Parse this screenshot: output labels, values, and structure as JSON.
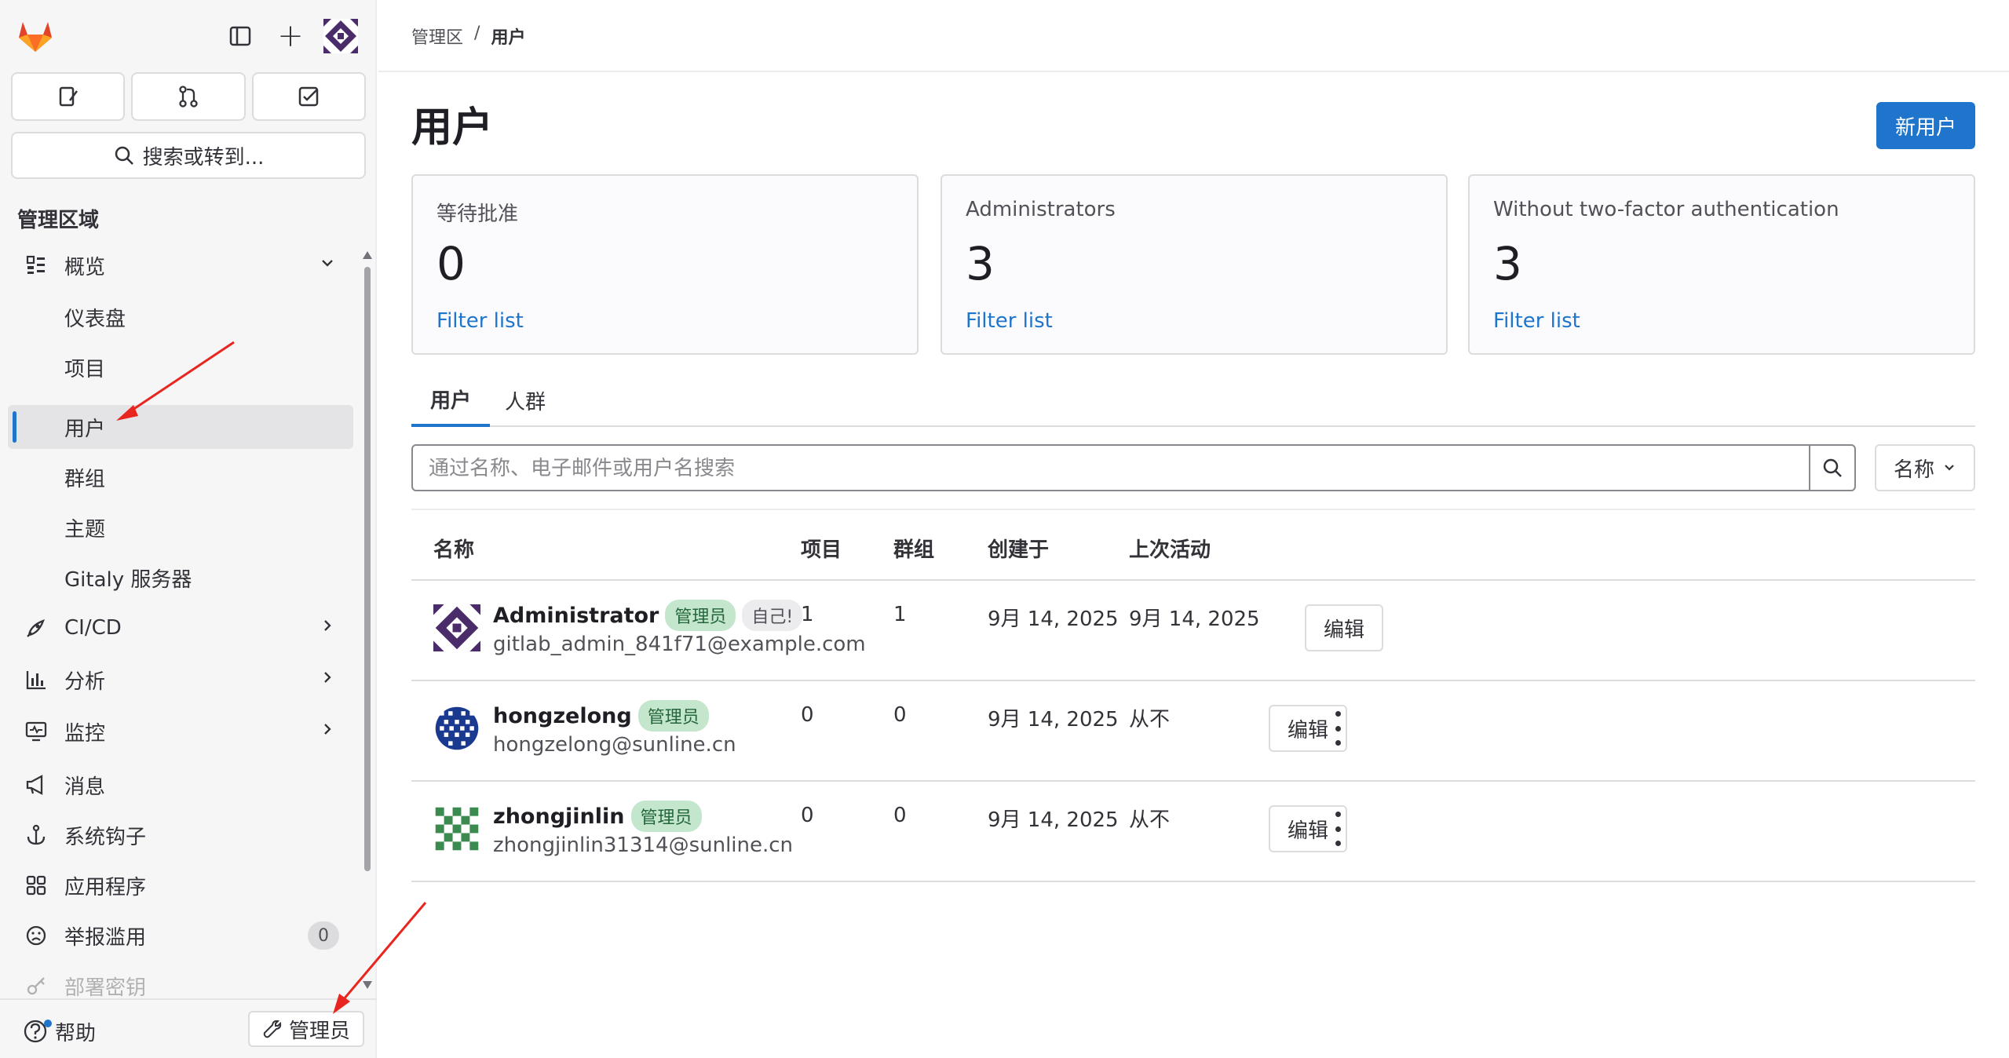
{
  "breadcrumb": {
    "root": "管理区",
    "separator": "/",
    "current": "用户"
  },
  "sidebar": {
    "search_label": "搜索或转到...",
    "section_title": "管理区域",
    "overview": {
      "label": "概览",
      "items": [
        "仪表盘",
        "项目",
        "用户",
        "群组",
        "主题",
        "Gitaly 服务器"
      ],
      "active": "用户"
    },
    "items": [
      {
        "label": "CI/CD",
        "icon": "rocket-icon"
      },
      {
        "label": "分析",
        "icon": "chart-icon"
      },
      {
        "label": "监控",
        "icon": "monitor-icon"
      },
      {
        "label": "消息",
        "icon": "megaphone-icon"
      },
      {
        "label": "系统钩子",
        "icon": "anchor-icon"
      },
      {
        "label": "应用程序",
        "icon": "apps-icon"
      },
      {
        "label": "举报滥用",
        "icon": "abuse-icon",
        "count": "0"
      },
      {
        "label": "部署密钥",
        "icon": "key-icon"
      }
    ],
    "help_label": "帮助",
    "admin_label": "管理员"
  },
  "page": {
    "title": "用户",
    "new_user_label": "新用户"
  },
  "stats": [
    {
      "label": "等待批准",
      "value": "0",
      "link": "Filter list"
    },
    {
      "label": "Administrators",
      "value": "3",
      "link": "Filter list"
    },
    {
      "label": "Without two-factor authentication",
      "value": "3",
      "link": "Filter list"
    }
  ],
  "tabs": [
    {
      "label": "用户",
      "active": true
    },
    {
      "label": "人群",
      "active": false
    }
  ],
  "search": {
    "placeholder": "通过名称、电子邮件或用户名搜索",
    "sort_label": "名称"
  },
  "table": {
    "headers": {
      "name": "名称",
      "projects": "项目",
      "groups": "群组",
      "created": "创建于",
      "last_activity": "上次活动"
    },
    "rows": [
      {
        "name": "Administrator",
        "badges": [
          "管理员",
          "自己!"
        ],
        "email": "gitlab_admin_841f71@example.com",
        "projects": "1",
        "groups": "1",
        "created": "9月 14, 2025",
        "last_activity": "9月 14, 2025",
        "edit": "编辑"
      },
      {
        "name": "hongzelong",
        "badges": [
          "管理员"
        ],
        "email": "hongzelong@sunline.cn",
        "projects": "0",
        "groups": "0",
        "created": "9月 14, 2025",
        "last_activity": "从不",
        "edit": "编辑"
      },
      {
        "name": "zhongjinlin",
        "badges": [
          "管理员"
        ],
        "email": "zhongjinlin31314@sunline.cn",
        "projects": "0",
        "groups": "0",
        "created": "9月 14, 2025",
        "last_activity": "从不",
        "edit": "编辑"
      }
    ]
  },
  "colors": {
    "accent": "#1f75cb",
    "admin_badge": "#c3e6cd",
    "annotation_arrow": "#e8261f"
  }
}
